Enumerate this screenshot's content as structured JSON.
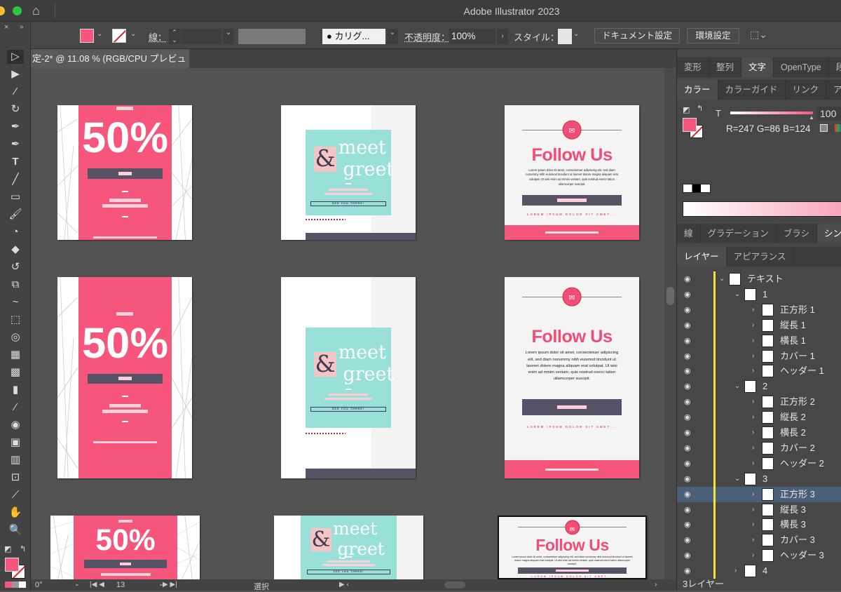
{
  "app": {
    "title": "Adobe Illustrator 2023"
  },
  "control": {
    "stroke_label": "線：",
    "brush": "カリグ...",
    "opacity_label": "不透明度：",
    "opacity": "100%",
    "style_label": "スタイル：",
    "doc_setup": "ドキュメント設定",
    "prefs": "環境設定",
    "fill_color": "#f7567c"
  },
  "doc_tab": "定-2* @ 11.08 % (RGB/CPU プレビュー)",
  "panel": {
    "tabs1": [
      "変形",
      "整列",
      "文字",
      "OpenType",
      "段落"
    ],
    "tabs2": [
      "カラー",
      "カラーガイド",
      "リンク",
      "アセ"
    ],
    "tint_label": "T",
    "tint": "100",
    "rgb": "R=247 G=86 B=124",
    "tabs3": [
      "線",
      "グラデーション",
      "ブラシ",
      "シンボ"
    ],
    "tabs4": [
      "レイヤー",
      "アピアランス"
    ],
    "layers": [
      {
        "name": "テキスト",
        "level": 0,
        "open": true
      },
      {
        "name": "1",
        "level": 1,
        "open": true
      },
      {
        "name": "正方形 1",
        "level": 2
      },
      {
        "name": "縦長 1",
        "level": 2
      },
      {
        "name": "横長 1",
        "level": 2
      },
      {
        "name": "カバー 1",
        "level": 2
      },
      {
        "name": "ヘッダー 1",
        "level": 2
      },
      {
        "name": "2",
        "level": 1,
        "open": true
      },
      {
        "name": "正方形 2",
        "level": 2
      },
      {
        "name": "縦長 2",
        "level": 2
      },
      {
        "name": "横長 2",
        "level": 2
      },
      {
        "name": "カバー 2",
        "level": 2
      },
      {
        "name": "ヘッダー 2",
        "level": 2
      },
      {
        "name": "3",
        "level": 1,
        "open": true
      },
      {
        "name": "正方形 3",
        "level": 2,
        "selected": true
      },
      {
        "name": "縦長 3",
        "level": 2
      },
      {
        "name": "横長 3",
        "level": 2
      },
      {
        "name": "カバー 3",
        "level": 2
      },
      {
        "name": "ヘッダー 3",
        "level": 2
      },
      {
        "name": "4",
        "level": 1,
        "open": false
      }
    ],
    "layer_count": "3レイヤー"
  },
  "status": {
    "rotation": "0°",
    "artboard": "13",
    "mode": "選択"
  },
  "artboards": {
    "sale_percent": "50%",
    "meet": "meet",
    "amp": "&",
    "greet": "greet",
    "see_you": "SEE YOU THERE!",
    "follow": "Follow Us",
    "lorem": "Lorem ipsum dolor sit amet, consectetuer adipiscing elit, sed diam nonummy nibh euismod tincidunt ut laoreet dolore magna aliquam erat volutpat. Ut wisi enim ad minim veniam, quis nostrud exerci tation ullamcorper suscipit.",
    "lorem_caps": "LOREM IPSUM DOLOR SIT AMET...",
    "colors": {
      "pink": "#f7567c",
      "teal": "#98e0d8",
      "navy": "#575367"
    }
  }
}
